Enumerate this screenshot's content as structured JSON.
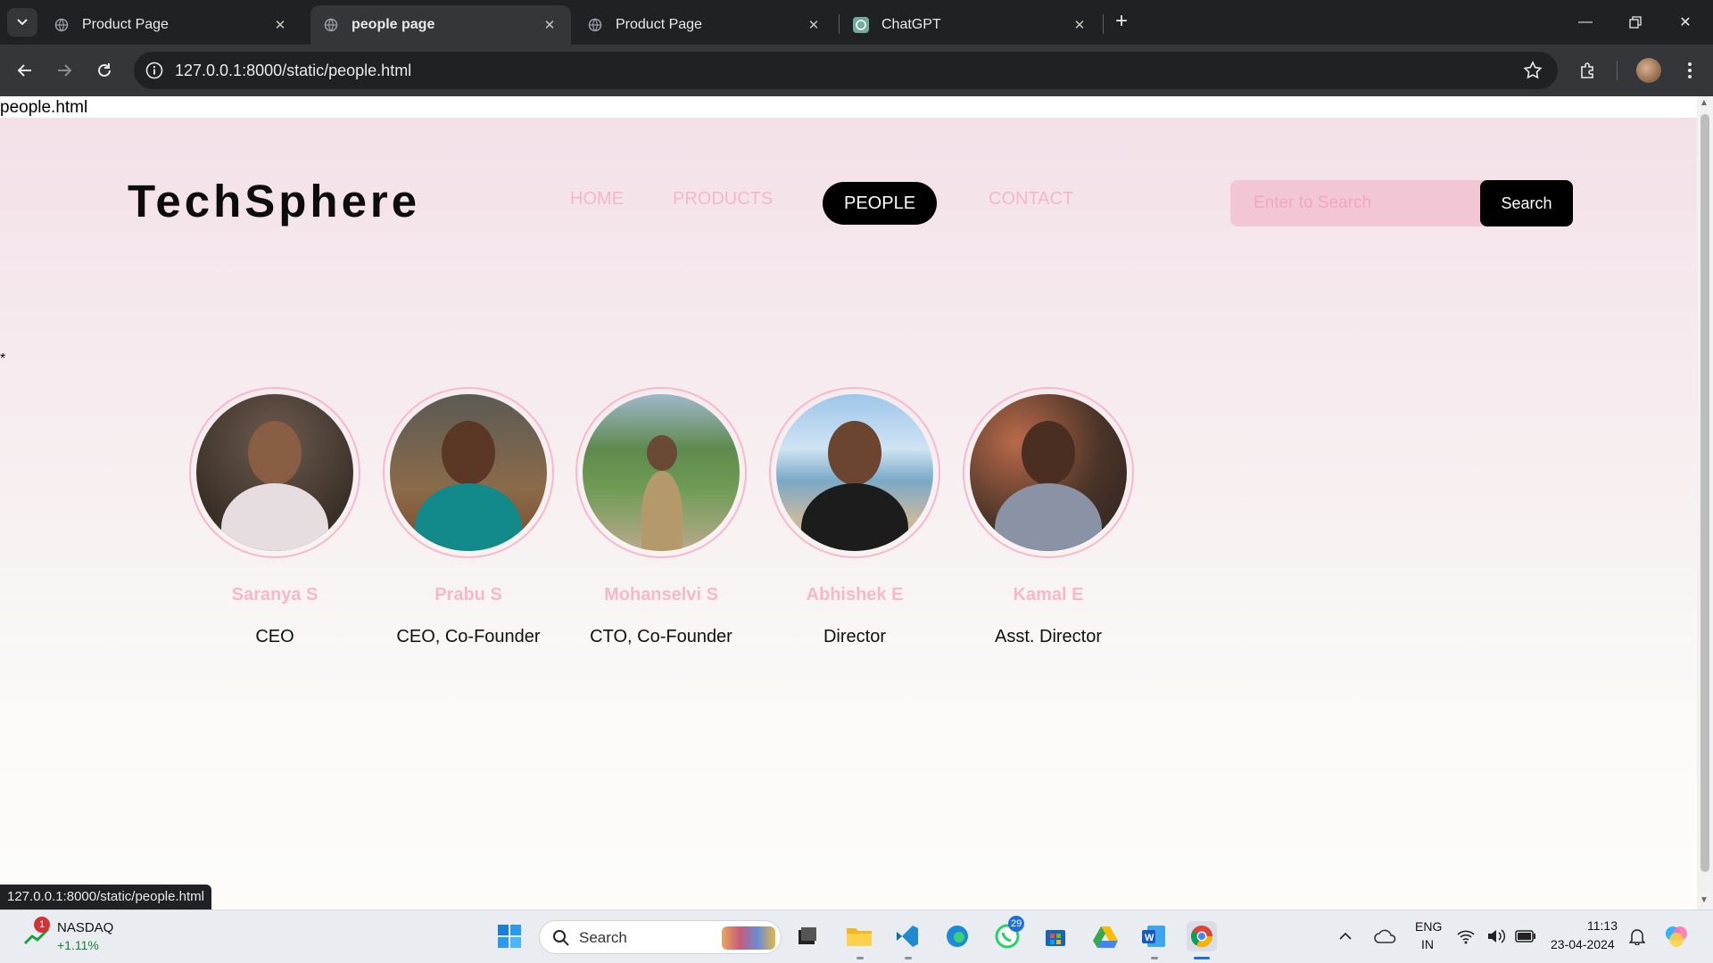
{
  "browser": {
    "tabs": [
      {
        "title": "Product Page",
        "active": false
      },
      {
        "title": "people page",
        "active": true
      },
      {
        "title": "Product Page",
        "active": false
      },
      {
        "title": "ChatGPT",
        "active": false
      }
    ],
    "url": "127.0.0.1:8000/static/people.html",
    "status_url": "127.0.0.1:8000/static/people.html"
  },
  "page": {
    "filename_text": "people.html",
    "stray_text": "*",
    "brand": "TechSphere",
    "nav": [
      "HOME",
      "PRODUCTS",
      "PEOPLE",
      "CONTACT"
    ],
    "active_nav": "PEOPLE",
    "search": {
      "placeholder": "Enter to Search",
      "button": "Search"
    },
    "people": [
      {
        "name": "Saranya S",
        "role": "CEO"
      },
      {
        "name": "Prabu S",
        "role": "CEO, Co-Founder"
      },
      {
        "name": "Mohanselvi S",
        "role": "CTO, Co-Founder"
      },
      {
        "name": "Abhishek E",
        "role": "Director"
      },
      {
        "name": "Kamal E",
        "role": "Asst. Director"
      }
    ],
    "colors": {
      "accent_pink": "#f6b8cc",
      "nav_active_bg": "#000000"
    }
  },
  "taskbar": {
    "stock": {
      "name": "NASDAQ",
      "change": "+1.11%",
      "badge": "1"
    },
    "search_label": "Search",
    "whatsapp_badge": "29",
    "language": [
      "ENG",
      "IN"
    ],
    "time": "11:13",
    "date": "23-04-2024"
  }
}
